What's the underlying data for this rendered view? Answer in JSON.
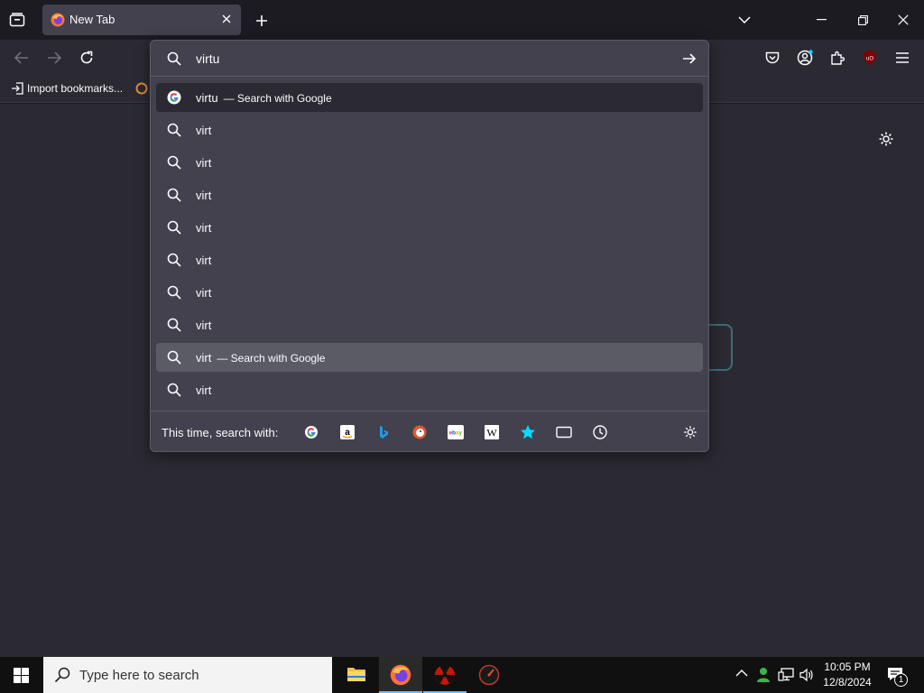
{
  "browser": {
    "tab_title": "New Tab",
    "bookmarks": {
      "import_label": "Import bookmarks..."
    }
  },
  "urlbar": {
    "input_value": "virtu",
    "results": [
      {
        "text": "virtu",
        "suffix": "— Search with Google",
        "icon": "google-icon",
        "state": "selected"
      },
      {
        "text": "virt",
        "suffix": "",
        "icon": "search-icon",
        "state": ""
      },
      {
        "text": "virt",
        "suffix": "",
        "icon": "search-icon",
        "state": ""
      },
      {
        "text": "virt",
        "suffix": "",
        "icon": "search-icon",
        "state": ""
      },
      {
        "text": "virt",
        "suffix": "",
        "icon": "search-icon",
        "state": ""
      },
      {
        "text": "virt",
        "suffix": "",
        "icon": "search-icon",
        "state": ""
      },
      {
        "text": "virt",
        "suffix": "",
        "icon": "search-icon",
        "state": ""
      },
      {
        "text": "virt",
        "suffix": "",
        "icon": "search-icon",
        "state": ""
      },
      {
        "text": "virt",
        "suffix": "— Search with Google",
        "icon": "search-icon",
        "state": "hover"
      },
      {
        "text": "virt",
        "suffix": "",
        "icon": "search-icon",
        "state": ""
      }
    ],
    "oneoff_label": "This time, search with:",
    "engines": [
      "google",
      "amazon",
      "bing",
      "duckduckgo",
      "ebay",
      "wikipedia",
      "bookmarks",
      "tabs",
      "history"
    ]
  },
  "taskbar": {
    "search_placeholder": "Type here to search",
    "time": "10:05 PM",
    "date": "12/8/2024",
    "notification_count": "1"
  },
  "colors": {
    "accent": "#00ddff",
    "panel": "#42414d",
    "toolbar": "#2b2a33",
    "frame": "#1c1b22"
  }
}
